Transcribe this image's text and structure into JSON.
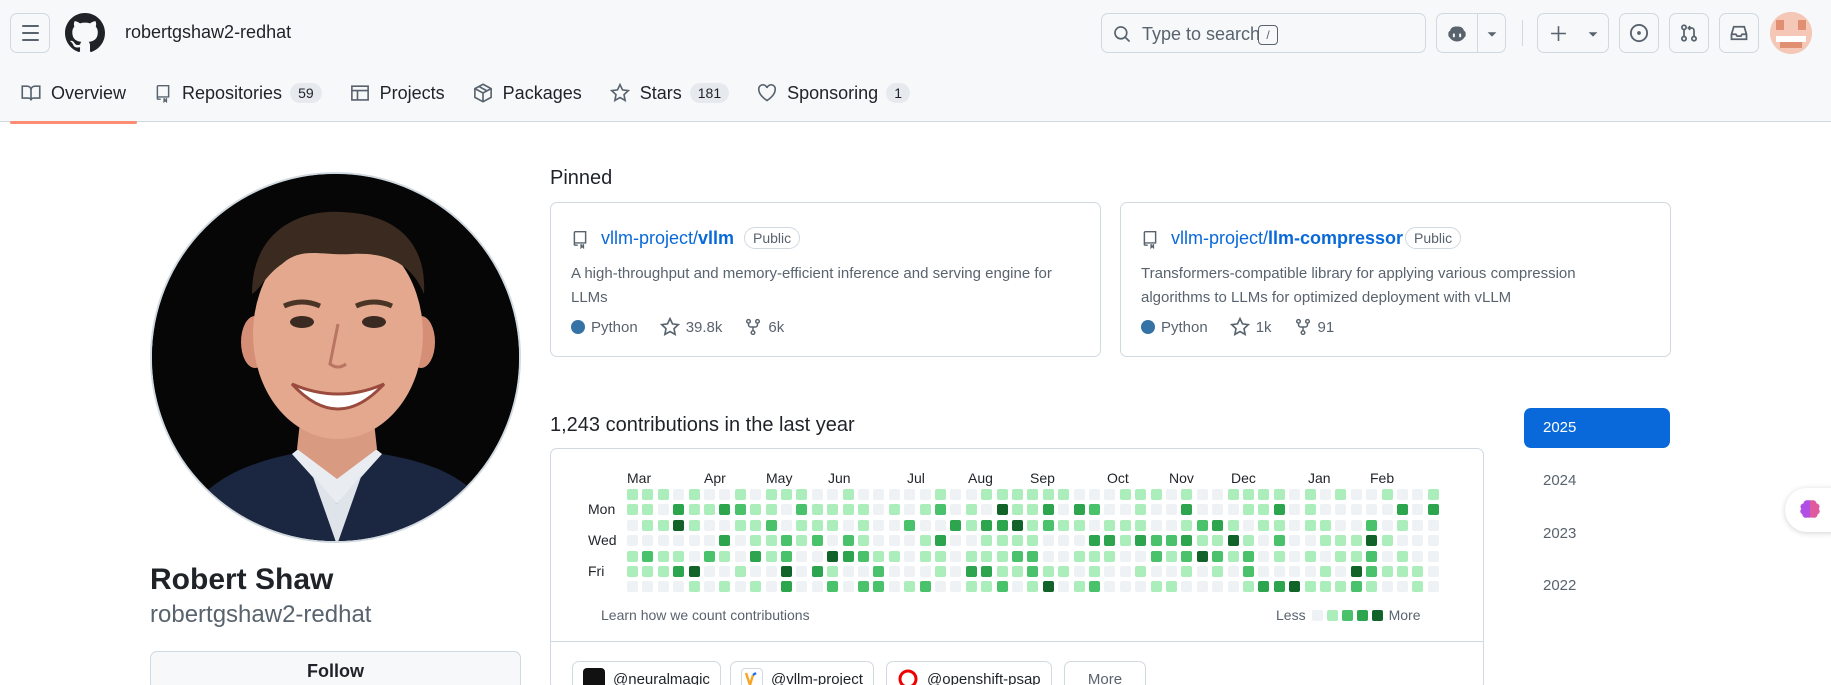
{
  "header": {
    "username": "robertgshaw2-redhat",
    "search_placeholder": "Type to search",
    "search_shortcut": "/"
  },
  "tabs": [
    {
      "label": "Overview",
      "icon": "book-icon"
    },
    {
      "label": "Repositories",
      "count": "59",
      "icon": "repo-icon"
    },
    {
      "label": "Projects",
      "icon": "table-icon"
    },
    {
      "label": "Packages",
      "icon": "package-icon"
    },
    {
      "label": "Stars",
      "count": "181",
      "icon": "star-icon"
    },
    {
      "label": "Sponsoring",
      "count": "1",
      "icon": "heart-icon"
    }
  ],
  "profile": {
    "name": "Robert Shaw",
    "login": "robertgshaw2-redhat",
    "follow_label": "Follow"
  },
  "pinned": {
    "heading": "Pinned",
    "items": [
      {
        "owner": "vllm-project/",
        "repo": "vllm",
        "visibility": "Public",
        "description": "A high-throughput and memory-efficient inference and serving engine for LLMs",
        "language": "Python",
        "stars": "39.8k",
        "forks": "6k"
      },
      {
        "owner": "vllm-project/",
        "repo": "llm-compressor",
        "visibility": "Public",
        "description": "Transformers-compatible library for applying various compression algorithms to LLMs for optimized deployment with vLLM",
        "language": "Python",
        "stars": "1k",
        "forks": "91"
      }
    ]
  },
  "contributions": {
    "heading": "1,243 contributions in the last year",
    "months": [
      "Mar",
      "Apr",
      "May",
      "Jun",
      "Jul",
      "Aug",
      "Sep",
      "Oct",
      "Nov",
      "Dec",
      "Jan",
      "Feb"
    ],
    "days": [
      "Mon",
      "Wed",
      "Fri"
    ],
    "learn_link": "Learn how we count contributions",
    "legend_less": "Less",
    "legend_more": "More",
    "colors": [
      "#eff2f5",
      "#aceebb",
      "#4ac26b",
      "#2da44e",
      "#116329"
    ]
  },
  "orgs": [
    {
      "label": "@neuralmagic"
    },
    {
      "label": "@vllm-project"
    },
    {
      "label": "@openshift-psap"
    },
    {
      "label": "More"
    }
  ],
  "years": [
    "2025",
    "2024",
    "2023",
    "2022"
  ]
}
